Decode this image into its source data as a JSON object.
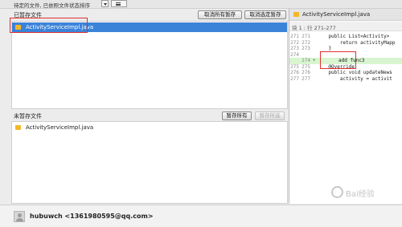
{
  "toolbar": {
    "filter_label": "待定的文件, 已依照文件状态排序",
    "view_icon": "list-icon",
    "dropdown_icon": "chevron-down-icon"
  },
  "staged": {
    "title": "已暂存文件",
    "buttons": {
      "unstage_all": "取消所有暂存",
      "unstage_selected": "取消选定暂存"
    },
    "files": [
      {
        "name": "ActivityServiceImpl.java",
        "selected": true,
        "icon": "java-file-icon"
      }
    ]
  },
  "unstaged": {
    "title": "未暂存文件",
    "buttons": {
      "stage_all": "暂存所有",
      "stage_selected": "暂存所选"
    },
    "files": [
      {
        "name": "ActivityServiceImpl.java",
        "icon": "java-file-icon"
      }
    ]
  },
  "diff": {
    "file_name": "ActivityServiceImpl.java",
    "hunk_header": "块 1 : 行 271-277",
    "lines": [
      {
        "a": "271",
        "b": "271",
        "text": "    public List<Activity> ",
        "added": false
      },
      {
        "a": "272",
        "b": "272",
        "text": "        return activityMapp",
        "added": false
      },
      {
        "a": "273",
        "b": "273",
        "text": "    }",
        "added": false
      },
      {
        "a": "274",
        "b": "",
        "text": "",
        "added": false
      },
      {
        "a": "",
        "b": "274",
        "text": "add func3",
        "added": true
      },
      {
        "a": "275",
        "b": "275",
        "text": "    @Override",
        "added": false
      },
      {
        "a": "276",
        "b": "276",
        "text": "    public void updateNews",
        "added": false
      },
      {
        "a": "277",
        "b": "277",
        "text": "        activity = activit",
        "added": false
      }
    ],
    "colors": {
      "added_bg": "#d8f5d0",
      "selection": "#3b83d9",
      "annotation": "#e23030"
    }
  },
  "watermark": {
    "text": "Bai经验"
  },
  "footer": {
    "author": "hubuwch <1361980595@qq.com>"
  }
}
